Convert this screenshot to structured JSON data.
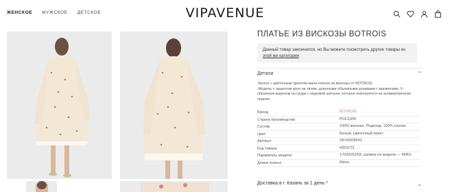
{
  "nav": {
    "women": "ЖЕНСКОЕ",
    "men": "МУЖСКОЕ",
    "kids": "ДЕТСКОЕ"
  },
  "logo": "VIPAVENUE",
  "header_icons": [
    "search-icon",
    "heart-icon",
    "user-icon",
    "bag-icon"
  ],
  "product": {
    "title": "ПЛАТЬЕ ИЗ ВИСКОЗЫ BOTROIS",
    "notice_text": "Данный товар закончился, но Вы можете посмотреть другие товары из ",
    "notice_link": "этой же категории",
    "details_label": "Детали",
    "description": [
      "-Белое с цветочным принтом мини-платье из вискозы от BOTROIS.",
      "-Модель с акцентом кроя на талии, длинными объемными рукавами с манжетами, V-образным вырезом на груди с отделкой шитьем, которое повторяется на асимметричном подоле."
    ],
    "specs": [
      {
        "key": "Бренд",
        "value": "BOTROIS"
      },
      {
        "key": "Страна производства",
        "value": "РОССИЯ"
      },
      {
        "key": "Состав",
        "value": "100% вискоза. Подклад: 100% хлопок"
      },
      {
        "key": "Цвет",
        "value": "Белый, Цветочный принт"
      },
      {
        "key": "Артикул",
        "value": "SKU0009643"
      },
      {
        "key": "Код товара",
        "value": "4353173"
      },
      {
        "key": "Параметры модели",
        "value": "170/92/62/93, размер на модели — 46RU"
      },
      {
        "key": "Длина платья",
        "value": "Мини"
      }
    ],
    "delivery": "Доставка в г. Казань за 1 день *"
  },
  "colors": {
    "brand_link": "#c9857a",
    "notice_bg": "#f2f2f2",
    "photo_bg": "#ebebeb"
  }
}
